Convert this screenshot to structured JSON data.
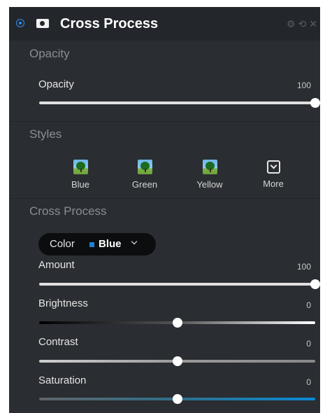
{
  "panel": {
    "title": "Cross Process",
    "icons": [
      "radio-on-icon",
      "mask-icon",
      "gear-icon",
      "reset-icon",
      "close-icon"
    ],
    "accent": "#2f8ef5"
  },
  "opacity_section": {
    "header": "Opacity",
    "opacity": {
      "label": "Opacity",
      "value": "100",
      "fraction": 1.0
    }
  },
  "styles_section": {
    "header": "Styles",
    "items": [
      {
        "label": "Blue"
      },
      {
        "label": "Green"
      },
      {
        "label": "Yellow"
      },
      {
        "label": "More"
      }
    ]
  },
  "cross_process_section": {
    "header": "Cross Process",
    "color": {
      "label": "Color",
      "value": "Blue",
      "swatch": "#1e7fd8"
    },
    "amount": {
      "label": "Amount",
      "value": "100",
      "fraction": 1.0
    },
    "brightness": {
      "label": "Brightness",
      "value": "0",
      "fraction": 0.5
    },
    "contrast": {
      "label": "Contrast",
      "value": "0",
      "fraction": 0.5
    },
    "saturation": {
      "label": "Saturation",
      "value": "0",
      "fraction": 0.5
    }
  }
}
